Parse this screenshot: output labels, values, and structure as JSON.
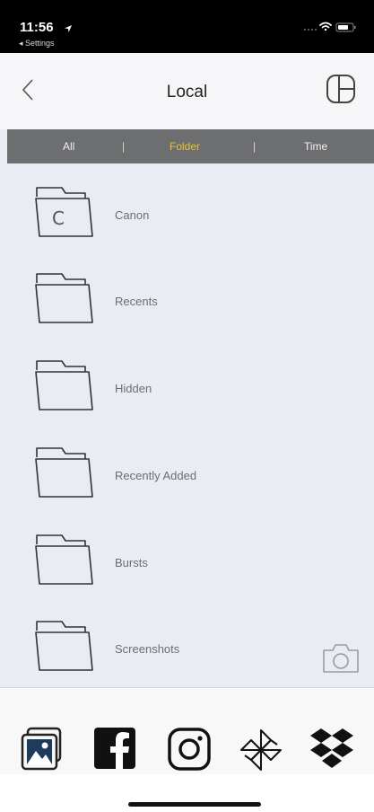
{
  "status_bar": {
    "time": "11:56",
    "back_label": "◂ Settings"
  },
  "nav": {
    "title": "Local",
    "back_icon": "chevron-left-icon",
    "layout_icon": "layout-grid-icon"
  },
  "filter": {
    "tabs": [
      {
        "label": "All",
        "active": false
      },
      {
        "label": "Folder",
        "active": true
      },
      {
        "label": "Time",
        "active": false
      }
    ],
    "separator": "|",
    "active_color": "#e8c431"
  },
  "folders": [
    {
      "label": "Canon",
      "letter": "C"
    },
    {
      "label": "Recents"
    },
    {
      "label": "Hidden"
    },
    {
      "label": "Recently Added"
    },
    {
      "label": "Bursts"
    },
    {
      "label": "Screenshots"
    }
  ],
  "camera_icon": "camera-icon",
  "sources": [
    {
      "name": "photos-icon"
    },
    {
      "name": "facebook-icon"
    },
    {
      "name": "instagram-icon"
    },
    {
      "name": "pinwheel-icon"
    },
    {
      "name": "dropbox-icon"
    }
  ],
  "colors": {
    "background": "#e9ecf3",
    "filter_bar": "#6d6e70",
    "active_tab": "#e8c431"
  }
}
